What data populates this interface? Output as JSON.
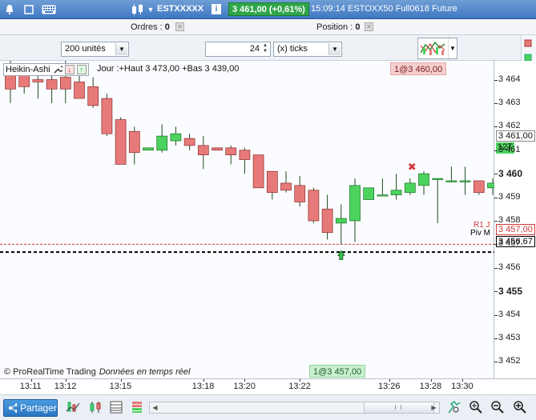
{
  "titlebar": {
    "symbol": "ESTXXXXX",
    "price_change": "3 461,00 (+0,61%)",
    "time": "15:09:14",
    "instrument": "ESTOXX50 Full0618 Future",
    "info_icon": "i"
  },
  "orders_bar": {
    "orders_label": "Ordres :",
    "orders_value": "0",
    "position_label": "Position :",
    "position_value": "0"
  },
  "toolbar": {
    "units_select": "200 unités",
    "ticks_value": "24",
    "ticks_select": "(x) ticks"
  },
  "chart": {
    "indicator_label": "Heikin-Ashi",
    "day_info": "Jour :+Haut 3 473,00 +Bas 3 439,00",
    "order_tag_top": "1@3 460,00",
    "order_tag_bottom": "1@3 457,00",
    "copyright": "© ProRealTime Trading",
    "realtime": "Données en temps réel",
    "r1_label": "R1 J",
    "pivot_label": "Piv M",
    "last_price_box": "3 461,00",
    "tick_count_box": "12T",
    "r1_price_box": "3 457,00",
    "pivot_price_box": "3 456,67",
    "colors": {
      "up": "#4cd35e",
      "down": "#e77a78",
      "r1": "#d23a3a",
      "pivot": "#000000"
    }
  },
  "chart_data": {
    "type": "candlestick",
    "title": "",
    "xlabel": "",
    "ylabel": "",
    "y_ticks": [
      "3 464",
      "3 463",
      "3 462",
      "3 461",
      "3 460",
      "3 459",
      "3 458",
      "3 457",
      "3 456",
      "3 455",
      "3 454",
      "3 453",
      "3 452"
    ],
    "y_bold_ticks": [
      "3 460",
      "3 455"
    ],
    "x_ticks": [
      "13:11",
      "13:12",
      "13:15",
      "13:18",
      "13:20",
      "13:22",
      "13:26",
      "13:28",
      "13:30"
    ],
    "ylim": [
      3451.3,
      3464.8
    ],
    "candles": [
      {
        "o": 3464.2,
        "h": 3464.8,
        "l": 3463.0,
        "c": 3463.6
      },
      {
        "o": 3464.2,
        "h": 3464.6,
        "l": 3463.4,
        "c": 3463.7
      },
      {
        "o": 3464.0,
        "h": 3464.4,
        "l": 3463.2,
        "c": 3463.9
      },
      {
        "o": 3464.0,
        "h": 3464.6,
        "l": 3463.0,
        "c": 3463.6
      },
      {
        "o": 3464.1,
        "h": 3464.8,
        "l": 3463.0,
        "c": 3463.6
      },
      {
        "o": 3463.9,
        "h": 3464.3,
        "l": 3463.2,
        "c": 3463.2
      },
      {
        "o": 3463.7,
        "h": 3464.1,
        "l": 3462.8,
        "c": 3462.9
      },
      {
        "o": 3463.2,
        "h": 3463.4,
        "l": 3461.6,
        "c": 3461.7
      },
      {
        "o": 3462.3,
        "h": 3462.4,
        "l": 3460.4,
        "c": 3460.4
      },
      {
        "o": 3461.8,
        "h": 3462.0,
        "l": 3460.4,
        "c": 3460.9
      },
      {
        "o": 3461.0,
        "h": 3461.0,
        "l": 3461.0,
        "c": 3461.1
      },
      {
        "o": 3461.0,
        "h": 3462.1,
        "l": 3460.9,
        "c": 3461.6
      },
      {
        "o": 3461.4,
        "h": 3462.0,
        "l": 3461.2,
        "c": 3461.7
      },
      {
        "o": 3461.5,
        "h": 3461.7,
        "l": 3461.0,
        "c": 3461.2
      },
      {
        "o": 3461.2,
        "h": 3461.6,
        "l": 3460.2,
        "c": 3460.8
      },
      {
        "o": 3461.1,
        "h": 3461.1,
        "l": 3461.0,
        "c": 3461.0
      },
      {
        "o": 3461.1,
        "h": 3461.2,
        "l": 3460.4,
        "c": 3460.8
      },
      {
        "o": 3461.0,
        "h": 3461.1,
        "l": 3460.0,
        "c": 3460.6
      },
      {
        "o": 3460.8,
        "h": 3460.8,
        "l": 3459.4,
        "c": 3459.4
      },
      {
        "o": 3460.1,
        "h": 3460.1,
        "l": 3458.9,
        "c": 3459.2
      },
      {
        "o": 3459.6,
        "h": 3460.1,
        "l": 3459.2,
        "c": 3459.3
      },
      {
        "o": 3459.5,
        "h": 3459.9,
        "l": 3458.6,
        "c": 3458.8
      },
      {
        "o": 3459.3,
        "h": 3459.4,
        "l": 3457.9,
        "c": 3458.0
      },
      {
        "o": 3458.5,
        "h": 3459.1,
        "l": 3457.2,
        "c": 3457.5
      },
      {
        "o": 3457.9,
        "h": 3458.7,
        "l": 3457.0,
        "c": 3458.1
      },
      {
        "o": 3458.0,
        "h": 3459.8,
        "l": 3457.1,
        "c": 3459.5
      },
      {
        "o": 3458.9,
        "h": 3459.4,
        "l": 3458.9,
        "c": 3459.4
      },
      {
        "o": 3459.1,
        "h": 3459.8,
        "l": 3459.1,
        "c": 3459.1
      },
      {
        "o": 3459.1,
        "h": 3460.0,
        "l": 3458.9,
        "c": 3459.3
      },
      {
        "o": 3459.2,
        "h": 3459.8,
        "l": 3459.1,
        "c": 3459.6
      },
      {
        "o": 3459.5,
        "h": 3460.1,
        "l": 3459.1,
        "c": 3460.0
      },
      {
        "o": 3459.8,
        "h": 3459.8,
        "l": 3457.9,
        "c": 3459.8
      },
      {
        "o": 3459.7,
        "h": 3460.3,
        "l": 3459.7,
        "c": 3459.7
      },
      {
        "o": 3459.7,
        "h": 3460.3,
        "l": 3459.1,
        "c": 3459.7
      },
      {
        "o": 3459.7,
        "h": 3459.7,
        "l": 3459.1,
        "c": 3459.2
      },
      {
        "o": 3459.4,
        "h": 3459.8,
        "l": 3459.1,
        "c": 3459.6
      },
      {
        "o": 3459.6,
        "h": 3460.0,
        "l": 3459.2,
        "c": 3460.0
      }
    ],
    "r1": 3457.0,
    "pivot": 3456.67,
    "order_top_price": 3460.0,
    "order_bottom_price": 3457.0
  }
}
